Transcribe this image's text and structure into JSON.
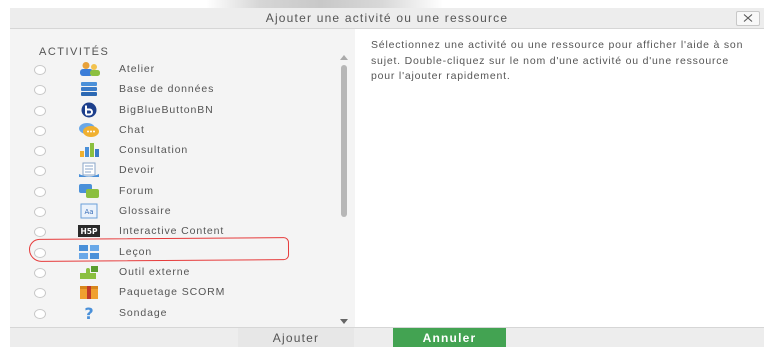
{
  "dialog": {
    "title": "Ajouter une activité ou une ressource",
    "close_icon": "close-icon"
  },
  "activities": {
    "heading": "ACTIVITÉS",
    "items": [
      {
        "label": "Atelier",
        "icon": "workshop-icon"
      },
      {
        "label": "Base de données",
        "icon": "database-icon"
      },
      {
        "label": "BigBlueButtonBN",
        "icon": "bigbluebutton-icon"
      },
      {
        "label": "Chat",
        "icon": "chat-icon"
      },
      {
        "label": "Consultation",
        "icon": "consultation-icon"
      },
      {
        "label": "Devoir",
        "icon": "assignment-icon"
      },
      {
        "label": "Forum",
        "icon": "forum-icon"
      },
      {
        "label": "Glossaire",
        "icon": "glossary-icon"
      },
      {
        "label": "Interactive Content",
        "icon": "h5p-icon",
        "highlighted": true
      },
      {
        "label": "Leçon",
        "icon": "lesson-icon"
      },
      {
        "label": "Outil externe",
        "icon": "external-tool-icon"
      },
      {
        "label": "Paquetage SCORM",
        "icon": "scorm-package-icon"
      },
      {
        "label": "Sondage",
        "icon": "survey-icon"
      }
    ]
  },
  "help_text": "Sélectionnez une activité ou une ressource pour afficher l'aide à son sujet. Double-cliquez sur le nom d'une activité ou d'une ressource pour l'ajouter rapidement.",
  "footer": {
    "add_label": "Ajouter",
    "cancel_label": "Annuler"
  },
  "colors": {
    "accent_green": "#43a352",
    "annotation_red": "#e63b3b"
  }
}
